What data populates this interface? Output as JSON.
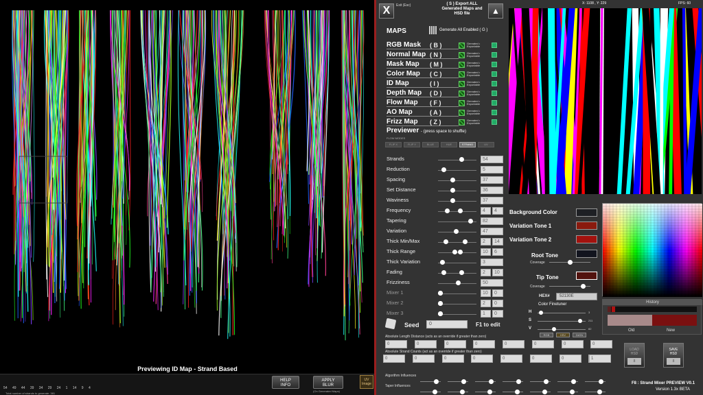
{
  "left_panel": {
    "preview_label": "Previewing ID Map - Strand Based",
    "strand_numbers": "54 49 44 39 34 29 24 1 14 9 4",
    "total_strands_label": "Total number of strands to generate: 381",
    "help_button": "HELP\nINFO",
    "apply_button": "APPLY\nBLUR",
    "apply_sub": "(On Generated Maps)",
    "uv_label": "UV\nImage"
  },
  "header": {
    "close_label": "X",
    "exit_label": "Exit (Esc)",
    "export_label": "( S ) Export ALL Generated Maps and HSD file",
    "upload_icon": "upload-icon"
  },
  "maps": {
    "title": "MAPS",
    "generate_all": "Generate All Enabled ( G )",
    "status_text": "Genrated • Exportable",
    "items": [
      {
        "name": "RGB Mask",
        "key": "( B )"
      },
      {
        "name": "Normal Map",
        "key": "( N )"
      },
      {
        "name": "Mask Map",
        "key": "( M )"
      },
      {
        "name": "Color Map",
        "key": "( C )"
      },
      {
        "name": "ID Map",
        "key": "( I )"
      },
      {
        "name": "Depth Map",
        "key": "( D )"
      },
      {
        "name": "Flow Map",
        "key": "( F )"
      },
      {
        "name": "AO Map",
        "key": "( A )"
      },
      {
        "name": "Frizz Map",
        "key": "( Z )"
      }
    ]
  },
  "previewer": {
    "title": "Previewer",
    "hint": "- (press space to shuffle)",
    "flow_modes_label": "FLOW MODES",
    "modes": [
      "FLIP X",
      "FLIP Y",
      "BLUE",
      "HUE",
      "STRAND",
      "UV"
    ]
  },
  "params": [
    {
      "label": "Strands",
      "v1": "54",
      "knob": 0.6
    },
    {
      "label": "Reduction",
      "v1": "5",
      "knob": 0.1
    },
    {
      "label": "Spacing",
      "v1": "37",
      "knob": 0.35
    },
    {
      "label": "Set Distance",
      "v1": "36",
      "knob": 0.35
    },
    {
      "label": "Waviness",
      "v1": "37",
      "knob": 0.35
    },
    {
      "label": "Frequency",
      "v1": "4",
      "v2": "4",
      "knob": 0.2,
      "knob2": 0.55
    },
    {
      "label": "Tapering",
      "v1": "82",
      "knob": 0.85
    },
    {
      "label": "Variation",
      "v1": "47",
      "knob": 0.45
    },
    {
      "label": "Thick Min/Max",
      "v1": "2",
      "v2": "14",
      "knob": 0.15,
      "knob2": 0.7
    },
    {
      "label": "Thick Range",
      "v1": "10",
      "v2": "6",
      "knob": 0.55,
      "knob2": 0.4
    },
    {
      "label": "Thick Variation",
      "v1": "3",
      "knob": 0.05
    },
    {
      "label": "Fading",
      "v1": "2",
      "v2": "10",
      "knob": 0.1,
      "knob2": 0.6
    },
    {
      "label": "Frizziness",
      "v1": "50",
      "knob": 0.5
    },
    {
      "label": "Mixer 1",
      "v1": "10",
      "v2": "0",
      "knob": 0.0,
      "knob2": 0.0
    },
    {
      "label": "Mixer 2",
      "v1": "2",
      "v2": "0",
      "knob": 0.0,
      "knob2": 0.0
    },
    {
      "label": "Mixer 3",
      "v1": "1",
      "v2": "0",
      "knob": 0.0,
      "knob2": 0.0
    }
  ],
  "seed": {
    "label": "Seed",
    "value": "0",
    "f1": "F1 to edit"
  },
  "absolute": {
    "length_label": "Absolute Length Distance (acts as an override if greater than zero)",
    "length_values": [
      "0",
      "0",
      "0",
      "0",
      "0",
      "0",
      "0",
      "0",
      "0"
    ],
    "counts_label": "Absolute Strand Counts (act as an override if greater than zero)",
    "counts_values": [
      "0",
      "0",
      "0",
      "0",
      "0",
      "0",
      "0",
      "0",
      "1"
    ],
    "tiny_buttons": [
      "RGB",
      "HSV",
      "DATA"
    ],
    "load": "LOAD\nHSD",
    "save": "SAVE\nHSD",
    "load_val": "8",
    "save_val": "8"
  },
  "influences": {
    "algo": "Algorithm Influences",
    "taper": "Taper Influences"
  },
  "status": {
    "coords": "X: 1108 , Y: 229",
    "fps": "FPS: 60",
    "title_line": "F8 : Strand Mixer PREVIEW V0.1",
    "version": "Version 1.3x BETA"
  },
  "colors": {
    "background": {
      "label": "Background Color",
      "hex": "#1e2024"
    },
    "tone1": {
      "label": "Variation Tone 1",
      "hex": "#8a1a0e"
    },
    "tone2": {
      "label": "Variation Tone 2",
      "hex": "#a3120e"
    },
    "root": {
      "label": "Root Tone",
      "hex": "#12141e"
    },
    "tip": {
      "label": "Tip Tone",
      "hex": "#52130e"
    },
    "coverage_label": "Coverage",
    "hex_label": "HEX#",
    "hex_value": "52130E",
    "finetune": "Color Finetuner",
    "h": {
      "label": "H",
      "value": "3"
    },
    "s": {
      "label": "S",
      "value": "211"
    },
    "v": {
      "label": "V",
      "value": "82"
    }
  },
  "history": {
    "title": "History",
    "old": "Old",
    "new": "New"
  }
}
